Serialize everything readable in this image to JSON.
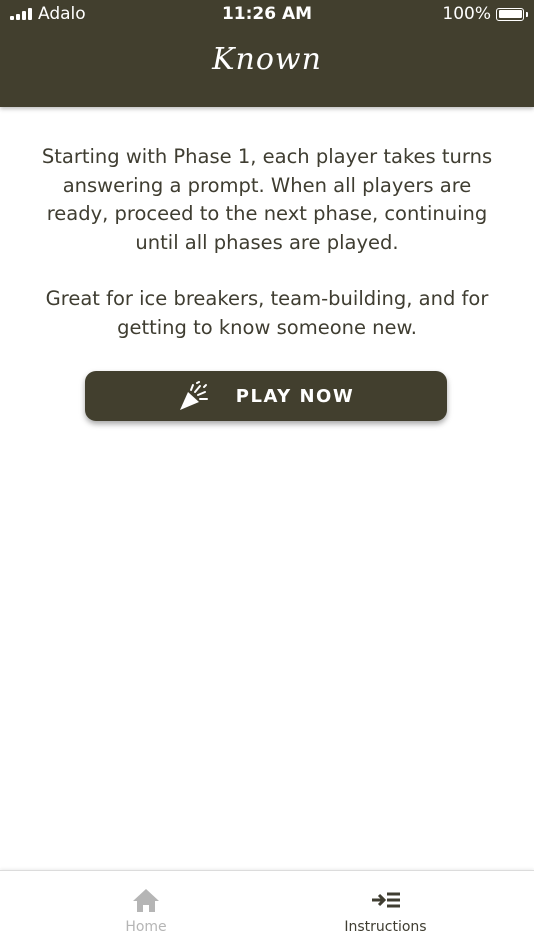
{
  "status_bar": {
    "carrier": "Adalo",
    "time": "11:26 AM",
    "battery": "100%",
    "battery_level": 1.0,
    "signal_icon": "signal-bars-icon",
    "battery_icon": "battery-icon"
  },
  "header": {
    "logo_text": "Known",
    "background_color": "#423f2e"
  },
  "main": {
    "paragraphs": [
      "Starting with Phase 1, each player takes turns answering a prompt. When all players are ready, proceed to the next phase, continuing until all phases are played.",
      "Great for ice breakers, team-building, and for getting to know someone new."
    ],
    "play_button": {
      "label": "PLAY NOW",
      "icon": "party-popper-icon"
    }
  },
  "tab_bar": {
    "tabs": [
      {
        "label": "Home",
        "icon": "home-icon",
        "active": false
      },
      {
        "label": "Instructions",
        "icon": "arrow-list-icon",
        "active": true
      }
    ]
  },
  "colors": {
    "brand": "#423f2e",
    "text": "#3f3d31",
    "tab_inactive": "#b5b5b5"
  }
}
